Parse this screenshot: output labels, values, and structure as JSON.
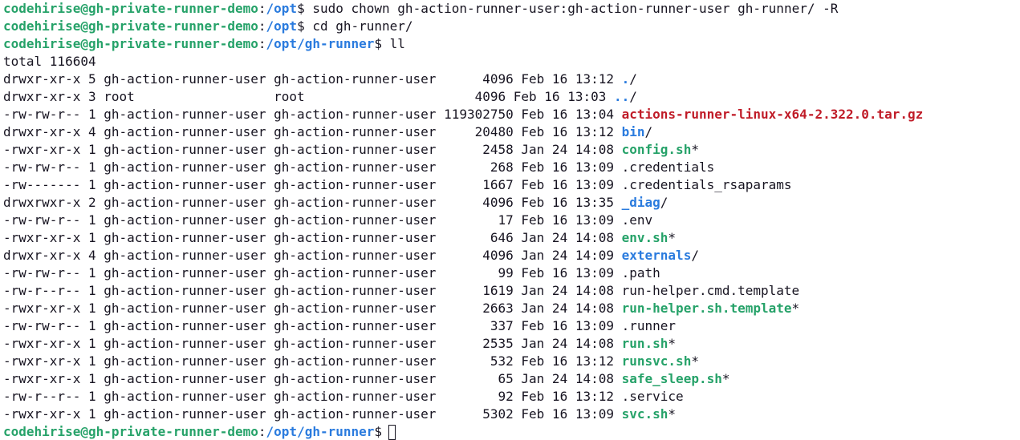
{
  "prompt": {
    "user_host": "codehirise@gh-private-runner-demo",
    "separator": ":",
    "symbol": "$"
  },
  "commands": [
    {
      "path": "/opt",
      "command": " sudo chown gh-action-runner-user:gh-action-runner-user gh-runner/ -R"
    },
    {
      "path": "/opt",
      "command": " cd gh-runner/"
    },
    {
      "path": "/opt/gh-runner",
      "command": " ll"
    }
  ],
  "listing": {
    "total": "total 116604",
    "rows": [
      {
        "prefix": "drwxr-xr-x 5 gh-action-runner-user gh-action-runner-user      4096 Feb 16 13:12 ",
        "name": ".",
        "suffix": "/",
        "type": "dir"
      },
      {
        "prefix": "drwxr-xr-x 3 root                  root                      4096 Feb 16 13:03 ",
        "name": "..",
        "suffix": "/",
        "type": "dir"
      },
      {
        "prefix": "-rw-rw-r-- 1 gh-action-runner-user gh-action-runner-user 119302750 Feb 16 13:04 ",
        "name": "actions-runner-linux-x64-2.322.0.tar.gz",
        "suffix": "",
        "type": "archive"
      },
      {
        "prefix": "drwxr-xr-x 4 gh-action-runner-user gh-action-runner-user     20480 Feb 16 13:12 ",
        "name": "bin",
        "suffix": "/",
        "type": "dir"
      },
      {
        "prefix": "-rwxr-xr-x 1 gh-action-runner-user gh-action-runner-user      2458 Jan 24 14:08 ",
        "name": "config.sh",
        "suffix": "*",
        "type": "exec"
      },
      {
        "prefix": "-rw-rw-r-- 1 gh-action-runner-user gh-action-runner-user       268 Feb 16 13:09 ",
        "name": ".credentials",
        "suffix": "",
        "type": "plain"
      },
      {
        "prefix": "-rw------- 1 gh-action-runner-user gh-action-runner-user      1667 Feb 16 13:09 ",
        "name": ".credentials_rsaparams",
        "suffix": "",
        "type": "plain"
      },
      {
        "prefix": "drwxrwxr-x 2 gh-action-runner-user gh-action-runner-user      4096 Feb 16 13:35 ",
        "name": "_diag",
        "suffix": "/",
        "type": "dir"
      },
      {
        "prefix": "-rw-rw-r-- 1 gh-action-runner-user gh-action-runner-user        17 Feb 16 13:09 ",
        "name": ".env",
        "suffix": "",
        "type": "plain"
      },
      {
        "prefix": "-rwxr-xr-x 1 gh-action-runner-user gh-action-runner-user       646 Jan 24 14:08 ",
        "name": "env.sh",
        "suffix": "*",
        "type": "exec"
      },
      {
        "prefix": "drwxr-xr-x 4 gh-action-runner-user gh-action-runner-user      4096 Jan 24 14:09 ",
        "name": "externals",
        "suffix": "/",
        "type": "dir"
      },
      {
        "prefix": "-rw-rw-r-- 1 gh-action-runner-user gh-action-runner-user        99 Feb 16 13:09 ",
        "name": ".path",
        "suffix": "",
        "type": "plain"
      },
      {
        "prefix": "-rw-r--r-- 1 gh-action-runner-user gh-action-runner-user      1619 Jan 24 14:08 ",
        "name": "run-helper.cmd.template",
        "suffix": "",
        "type": "plain"
      },
      {
        "prefix": "-rwxr-xr-x 1 gh-action-runner-user gh-action-runner-user      2663 Jan 24 14:08 ",
        "name": "run-helper.sh.template",
        "suffix": "*",
        "type": "exec"
      },
      {
        "prefix": "-rw-rw-r-- 1 gh-action-runner-user gh-action-runner-user       337 Feb 16 13:09 ",
        "name": ".runner",
        "suffix": "",
        "type": "plain"
      },
      {
        "prefix": "-rwxr-xr-x 1 gh-action-runner-user gh-action-runner-user      2535 Jan 24 14:08 ",
        "name": "run.sh",
        "suffix": "*",
        "type": "exec"
      },
      {
        "prefix": "-rwxr-xr-x 1 gh-action-runner-user gh-action-runner-user       532 Feb 16 13:12 ",
        "name": "runsvc.sh",
        "suffix": "*",
        "type": "exec"
      },
      {
        "prefix": "-rwxr-xr-x 1 gh-action-runner-user gh-action-runner-user        65 Jan 24 14:08 ",
        "name": "safe_sleep.sh",
        "suffix": "*",
        "type": "exec"
      },
      {
        "prefix": "-rw-r--r-- 1 gh-action-runner-user gh-action-runner-user        92 Feb 16 13:12 ",
        "name": ".service",
        "suffix": "",
        "type": "plain"
      },
      {
        "prefix": "-rwxr-xr-x 1 gh-action-runner-user gh-action-runner-user      5302 Feb 16 13:09 ",
        "name": "svc.sh",
        "suffix": "*",
        "type": "exec"
      }
    ]
  },
  "final_prompt": {
    "path": "/opt/gh-runner"
  },
  "colors": {
    "background": "#ffffff",
    "text": "#171421",
    "prompt_user": "#26a269",
    "directory": "#2a7bde",
    "executable": "#26a269",
    "archive": "#c01c28"
  }
}
